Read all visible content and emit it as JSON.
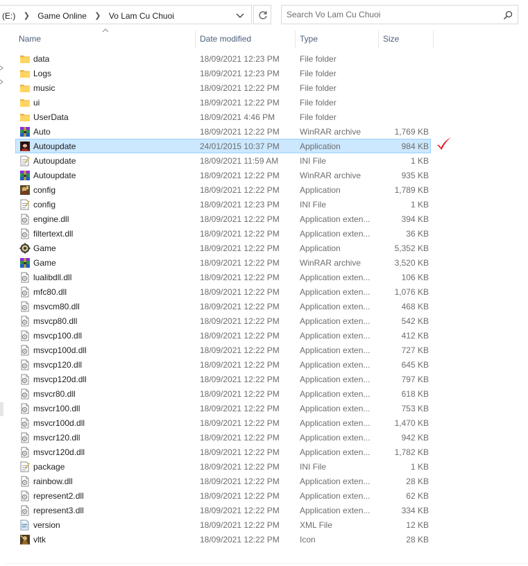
{
  "address": {
    "crumbs": [
      "(E:)",
      "Game Online",
      "Vo Lam Cu Chuoi"
    ]
  },
  "search": {
    "placeholder": "Search Vo Lam Cu Chuoi"
  },
  "columns": {
    "name": "Name",
    "date": "Date modified",
    "type": "Type",
    "size": "Size"
  },
  "colors": {
    "selection_bg": "#cce8ff",
    "selection_border": "#99d1ff",
    "header_text": "#4c607a",
    "check": "#e81123"
  },
  "files": [
    {
      "name": "data",
      "date": "18/09/2021 12:23 PM",
      "type": "File folder",
      "size": "",
      "icon": "folder-icon"
    },
    {
      "name": "Logs",
      "date": "18/09/2021 12:23 PM",
      "type": "File folder",
      "size": "",
      "icon": "folder-icon"
    },
    {
      "name": "music",
      "date": "18/09/2021 12:22 PM",
      "type": "File folder",
      "size": "",
      "icon": "folder-icon"
    },
    {
      "name": "ui",
      "date": "18/09/2021 12:22 PM",
      "type": "File folder",
      "size": "",
      "icon": "folder-icon"
    },
    {
      "name": "UserData",
      "date": "18/09/2021 4:46 PM",
      "type": "File folder",
      "size": "",
      "icon": "folder-icon"
    },
    {
      "name": "Auto",
      "date": "18/09/2021 12:22 PM",
      "type": "WinRAR archive",
      "size": "1,769 KB",
      "icon": "winrar-icon"
    },
    {
      "name": "Autoupdate",
      "date": "24/01/2015 10:37 PM",
      "type": "Application",
      "size": "984 KB",
      "icon": "app-portrait-icon",
      "selected": true
    },
    {
      "name": "Autoupdate",
      "date": "18/09/2021 11:59 AM",
      "type": "INI File",
      "size": "1 KB",
      "icon": "ini-file-icon"
    },
    {
      "name": "Autoupdate",
      "date": "18/09/2021 12:22 PM",
      "type": "WinRAR archive",
      "size": "935 KB",
      "icon": "winrar-icon"
    },
    {
      "name": "config",
      "date": "18/09/2021 12:22 PM",
      "type": "Application",
      "size": "1,789 KB",
      "icon": "app-game-icon"
    },
    {
      "name": "config",
      "date": "18/09/2021 12:23 PM",
      "type": "INI File",
      "size": "1 KB",
      "icon": "ini-file-icon"
    },
    {
      "name": "engine.dll",
      "date": "18/09/2021 12:22 PM",
      "type": "Application exten...",
      "size": "394 KB",
      "icon": "dll-icon"
    },
    {
      "name": "filtertext.dll",
      "date": "18/09/2021 12:22 PM",
      "type": "Application exten...",
      "size": "36 KB",
      "icon": "dll-icon"
    },
    {
      "name": "Game",
      "date": "18/09/2021 12:22 PM",
      "type": "Application",
      "size": "5,352 KB",
      "icon": "app-gear-icon"
    },
    {
      "name": "Game",
      "date": "18/09/2021 12:22 PM",
      "type": "WinRAR archive",
      "size": "3,520 KB",
      "icon": "winrar-icon"
    },
    {
      "name": "lualibdll.dll",
      "date": "18/09/2021 12:22 PM",
      "type": "Application exten...",
      "size": "106 KB",
      "icon": "dll-icon"
    },
    {
      "name": "mfc80.dll",
      "date": "18/09/2021 12:22 PM",
      "type": "Application exten...",
      "size": "1,076 KB",
      "icon": "dll-icon"
    },
    {
      "name": "msvcm80.dll",
      "date": "18/09/2021 12:22 PM",
      "type": "Application exten...",
      "size": "468 KB",
      "icon": "dll-icon"
    },
    {
      "name": "msvcp80.dll",
      "date": "18/09/2021 12:22 PM",
      "type": "Application exten...",
      "size": "542 KB",
      "icon": "dll-icon"
    },
    {
      "name": "msvcp100.dll",
      "date": "18/09/2021 12:22 PM",
      "type": "Application exten...",
      "size": "412 KB",
      "icon": "dll-icon"
    },
    {
      "name": "msvcp100d.dll",
      "date": "18/09/2021 12:22 PM",
      "type": "Application exten...",
      "size": "727 KB",
      "icon": "dll-icon"
    },
    {
      "name": "msvcp120.dll",
      "date": "18/09/2021 12:22 PM",
      "type": "Application exten...",
      "size": "645 KB",
      "icon": "dll-icon"
    },
    {
      "name": "msvcp120d.dll",
      "date": "18/09/2021 12:22 PM",
      "type": "Application exten...",
      "size": "797 KB",
      "icon": "dll-icon"
    },
    {
      "name": "msvcr80.dll",
      "date": "18/09/2021 12:22 PM",
      "type": "Application exten...",
      "size": "618 KB",
      "icon": "dll-icon"
    },
    {
      "name": "msvcr100.dll",
      "date": "18/09/2021 12:22 PM",
      "type": "Application exten...",
      "size": "753 KB",
      "icon": "dll-icon"
    },
    {
      "name": "msvcr100d.dll",
      "date": "18/09/2021 12:22 PM",
      "type": "Application exten...",
      "size": "1,470 KB",
      "icon": "dll-icon"
    },
    {
      "name": "msvcr120.dll",
      "date": "18/09/2021 12:22 PM",
      "type": "Application exten...",
      "size": "942 KB",
      "icon": "dll-icon"
    },
    {
      "name": "msvcr120d.dll",
      "date": "18/09/2021 12:22 PM",
      "type": "Application exten...",
      "size": "1,782 KB",
      "icon": "dll-icon"
    },
    {
      "name": "package",
      "date": "18/09/2021 12:22 PM",
      "type": "INI File",
      "size": "1 KB",
      "icon": "ini-file-icon"
    },
    {
      "name": "rainbow.dll",
      "date": "18/09/2021 12:22 PM",
      "type": "Application exten...",
      "size": "28 KB",
      "icon": "dll-icon"
    },
    {
      "name": "represent2.dll",
      "date": "18/09/2021 12:22 PM",
      "type": "Application exten...",
      "size": "62 KB",
      "icon": "dll-icon"
    },
    {
      "name": "represent3.dll",
      "date": "18/09/2021 12:22 PM",
      "type": "Application exten...",
      "size": "334 KB",
      "icon": "dll-icon"
    },
    {
      "name": "version",
      "date": "18/09/2021 12:22 PM",
      "type": "XML File",
      "size": "12 KB",
      "icon": "xml-file-icon"
    },
    {
      "name": "vltk",
      "date": "18/09/2021 12:22 PM",
      "type": "Icon",
      "size": "28 KB",
      "icon": "ico-file-icon"
    }
  ]
}
